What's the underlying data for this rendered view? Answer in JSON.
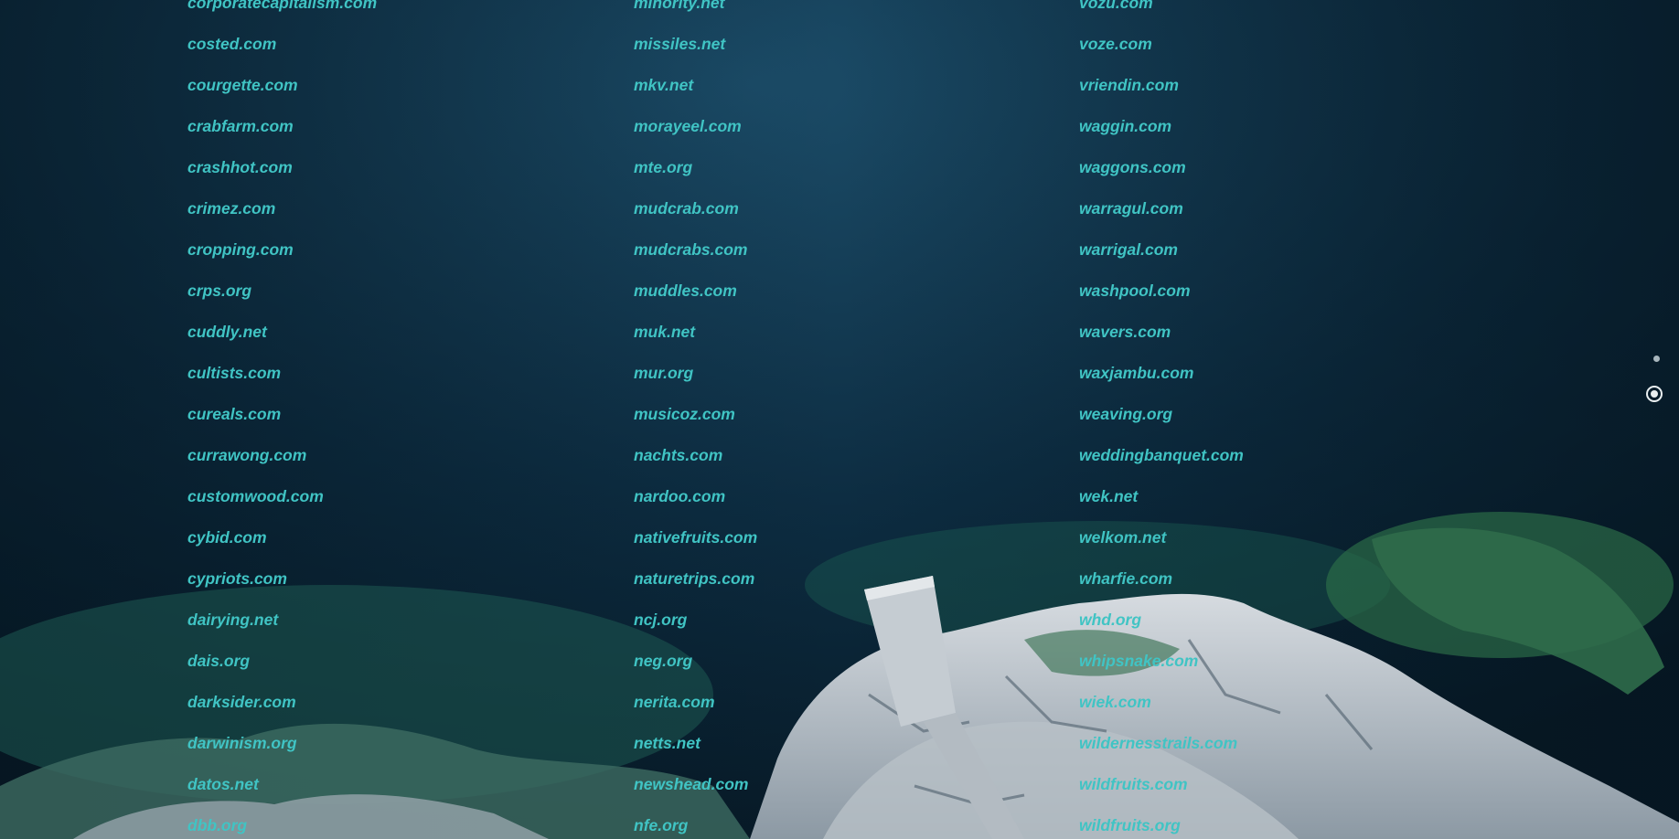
{
  "columns": [
    [
      "corporatecapitalism.com",
      "costed.com",
      "courgette.com",
      "crabfarm.com",
      "crashhot.com",
      "crimez.com",
      "cropping.com",
      "crps.org",
      "cuddly.net",
      "cultists.com",
      "cureals.com",
      "currawong.com",
      "customwood.com",
      "cybid.com",
      "cypriots.com",
      "dairying.net",
      "dais.org",
      "darksider.com",
      "darwinism.org",
      "datos.net",
      "dbb.org"
    ],
    [
      "minority.net",
      "missiles.net",
      "mkv.net",
      "morayeel.com",
      "mte.org",
      "mudcrab.com",
      "mudcrabs.com",
      "muddles.com",
      "muk.net",
      "mur.org",
      "musicoz.com",
      "nachts.com",
      "nardoo.com",
      "nativefruits.com",
      "naturetrips.com",
      "ncj.org",
      "neg.org",
      "nerita.com",
      "netts.net",
      "newshead.com",
      "nfe.org"
    ],
    [
      "vozu.com",
      "voze.com",
      "vriendin.com",
      "waggin.com",
      "waggons.com",
      "warragul.com",
      "warrigal.com",
      "washpool.com",
      "wavers.com",
      "waxjambu.com",
      "weaving.org",
      "weddingbanquet.com",
      "wek.net",
      "welkom.net",
      "wharfie.com",
      "whd.org",
      "whipsnake.com",
      "wiek.com",
      "wildernesstrails.com",
      "wildfruits.com",
      "wildfruits.org"
    ]
  ],
  "pager": {
    "dots": 2,
    "active_index": 1
  },
  "colors": {
    "link": "#40c4c4",
    "ocean": "#0b2536",
    "rock": "#c9ced4",
    "moss": "#2f6b4a"
  },
  "icons": {
    "pager_dot": "dot-icon",
    "pager_active": "radio-dot-icon"
  }
}
